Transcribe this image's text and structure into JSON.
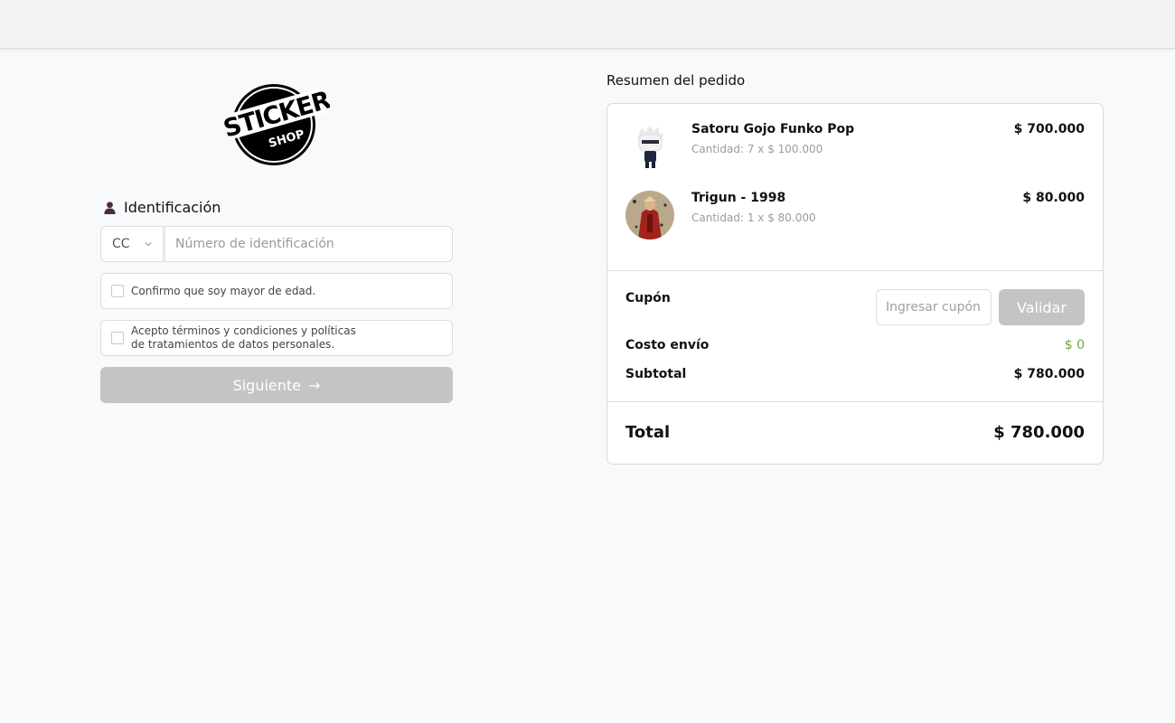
{
  "logo": {
    "line1": "STICKER",
    "line2": "SHOP"
  },
  "identification": {
    "title": "Identificación",
    "doc_type": "CC",
    "id_placeholder": "Número de identificación",
    "age_confirm": "Confirmo que soy mayor de edad.",
    "terms_line1": "Acepto términos y condiciones y políticas",
    "terms_line2": "de tratamientos de datos personales.",
    "next_label": "Siguiente",
    "next_arrow": "→"
  },
  "summary": {
    "title": "Resumen del pedido",
    "items": [
      {
        "name": "Satoru Gojo Funko Pop",
        "qty": "Cantidad: 7 x $ 100.000",
        "price": "$ 700.000"
      },
      {
        "name": "Trigun - 1998",
        "qty": "Cantidad: 1 x $ 80.000",
        "price": "$ 80.000"
      }
    ],
    "coupon_label": "Cupón",
    "coupon_placeholder": "Ingresar cupón",
    "validate_label": "Validar",
    "shipping_label": "Costo envío",
    "shipping_value": "$ 0",
    "subtotal_label": "Subtotal",
    "subtotal_value": "$ 780.000",
    "total_label": "Total",
    "total_value": "$ 780.000"
  },
  "colors": {
    "button_disabled": "#c4c4c4",
    "shipping_value": "#6aa84f",
    "user_icon": "#4a2c4a"
  }
}
